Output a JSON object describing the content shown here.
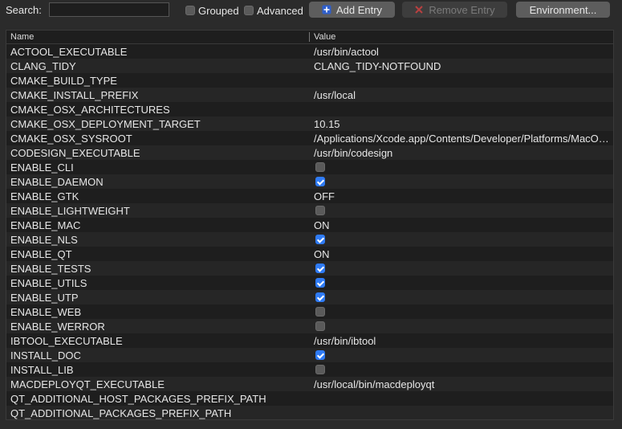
{
  "toolbar": {
    "search_label": "Search:",
    "search_value": "",
    "grouped_label": "Grouped",
    "grouped_checked": false,
    "advanced_label": "Advanced",
    "advanced_checked": false,
    "add_entry_label": "Add Entry",
    "remove_entry_label": "Remove Entry",
    "environment_label": "Environment..."
  },
  "table": {
    "columns": [
      "Name",
      "Value"
    ],
    "rows": [
      {
        "name": "ACTOOL_EXECUTABLE",
        "type": "text",
        "value": "/usr/bin/actool"
      },
      {
        "name": "CLANG_TIDY",
        "type": "text",
        "value": "CLANG_TIDY-NOTFOUND"
      },
      {
        "name": "CMAKE_BUILD_TYPE",
        "type": "text",
        "value": ""
      },
      {
        "name": "CMAKE_INSTALL_PREFIX",
        "type": "text",
        "value": "/usr/local"
      },
      {
        "name": "CMAKE_OSX_ARCHITECTURES",
        "type": "text",
        "value": ""
      },
      {
        "name": "CMAKE_OSX_DEPLOYMENT_TARGET",
        "type": "text",
        "value": "10.15"
      },
      {
        "name": "CMAKE_OSX_SYSROOT",
        "type": "text",
        "value": "/Applications/Xcode.app/Contents/Developer/Platforms/MacOSX.platform/Developer/SDKs/MacOSX.sdk"
      },
      {
        "name": "CODESIGN_EXECUTABLE",
        "type": "text",
        "value": "/usr/bin/codesign"
      },
      {
        "name": "ENABLE_CLI",
        "type": "bool",
        "checked": false
      },
      {
        "name": "ENABLE_DAEMON",
        "type": "bool",
        "checked": true
      },
      {
        "name": "ENABLE_GTK",
        "type": "text",
        "value": "OFF"
      },
      {
        "name": "ENABLE_LIGHTWEIGHT",
        "type": "bool",
        "checked": false
      },
      {
        "name": "ENABLE_MAC",
        "type": "text",
        "value": "ON"
      },
      {
        "name": "ENABLE_NLS",
        "type": "bool",
        "checked": true
      },
      {
        "name": "ENABLE_QT",
        "type": "text",
        "value": "ON"
      },
      {
        "name": "ENABLE_TESTS",
        "type": "bool",
        "checked": true
      },
      {
        "name": "ENABLE_UTILS",
        "type": "bool",
        "checked": true
      },
      {
        "name": "ENABLE_UTP",
        "type": "bool",
        "checked": true
      },
      {
        "name": "ENABLE_WEB",
        "type": "bool",
        "checked": false
      },
      {
        "name": "ENABLE_WERROR",
        "type": "bool",
        "checked": false
      },
      {
        "name": "IBTOOL_EXECUTABLE",
        "type": "text",
        "value": "/usr/bin/ibtool"
      },
      {
        "name": "INSTALL_DOC",
        "type": "bool",
        "checked": true
      },
      {
        "name": "INSTALL_LIB",
        "type": "bool",
        "checked": false
      },
      {
        "name": "MACDEPLOYQT_EXECUTABLE",
        "type": "text",
        "value": "/usr/local/bin/macdeployqt"
      },
      {
        "name": "QT_ADDITIONAL_HOST_PACKAGES_PREFIX_PATH",
        "type": "text",
        "value": ""
      },
      {
        "name": "QT_ADDITIONAL_PACKAGES_PREFIX_PATH",
        "type": "text",
        "value": ""
      }
    ]
  },
  "icons": {
    "add": "plus-icon",
    "remove": "x-icon"
  },
  "colors": {
    "accent": "#2f7bf5",
    "remove_icon": "#b84040"
  }
}
